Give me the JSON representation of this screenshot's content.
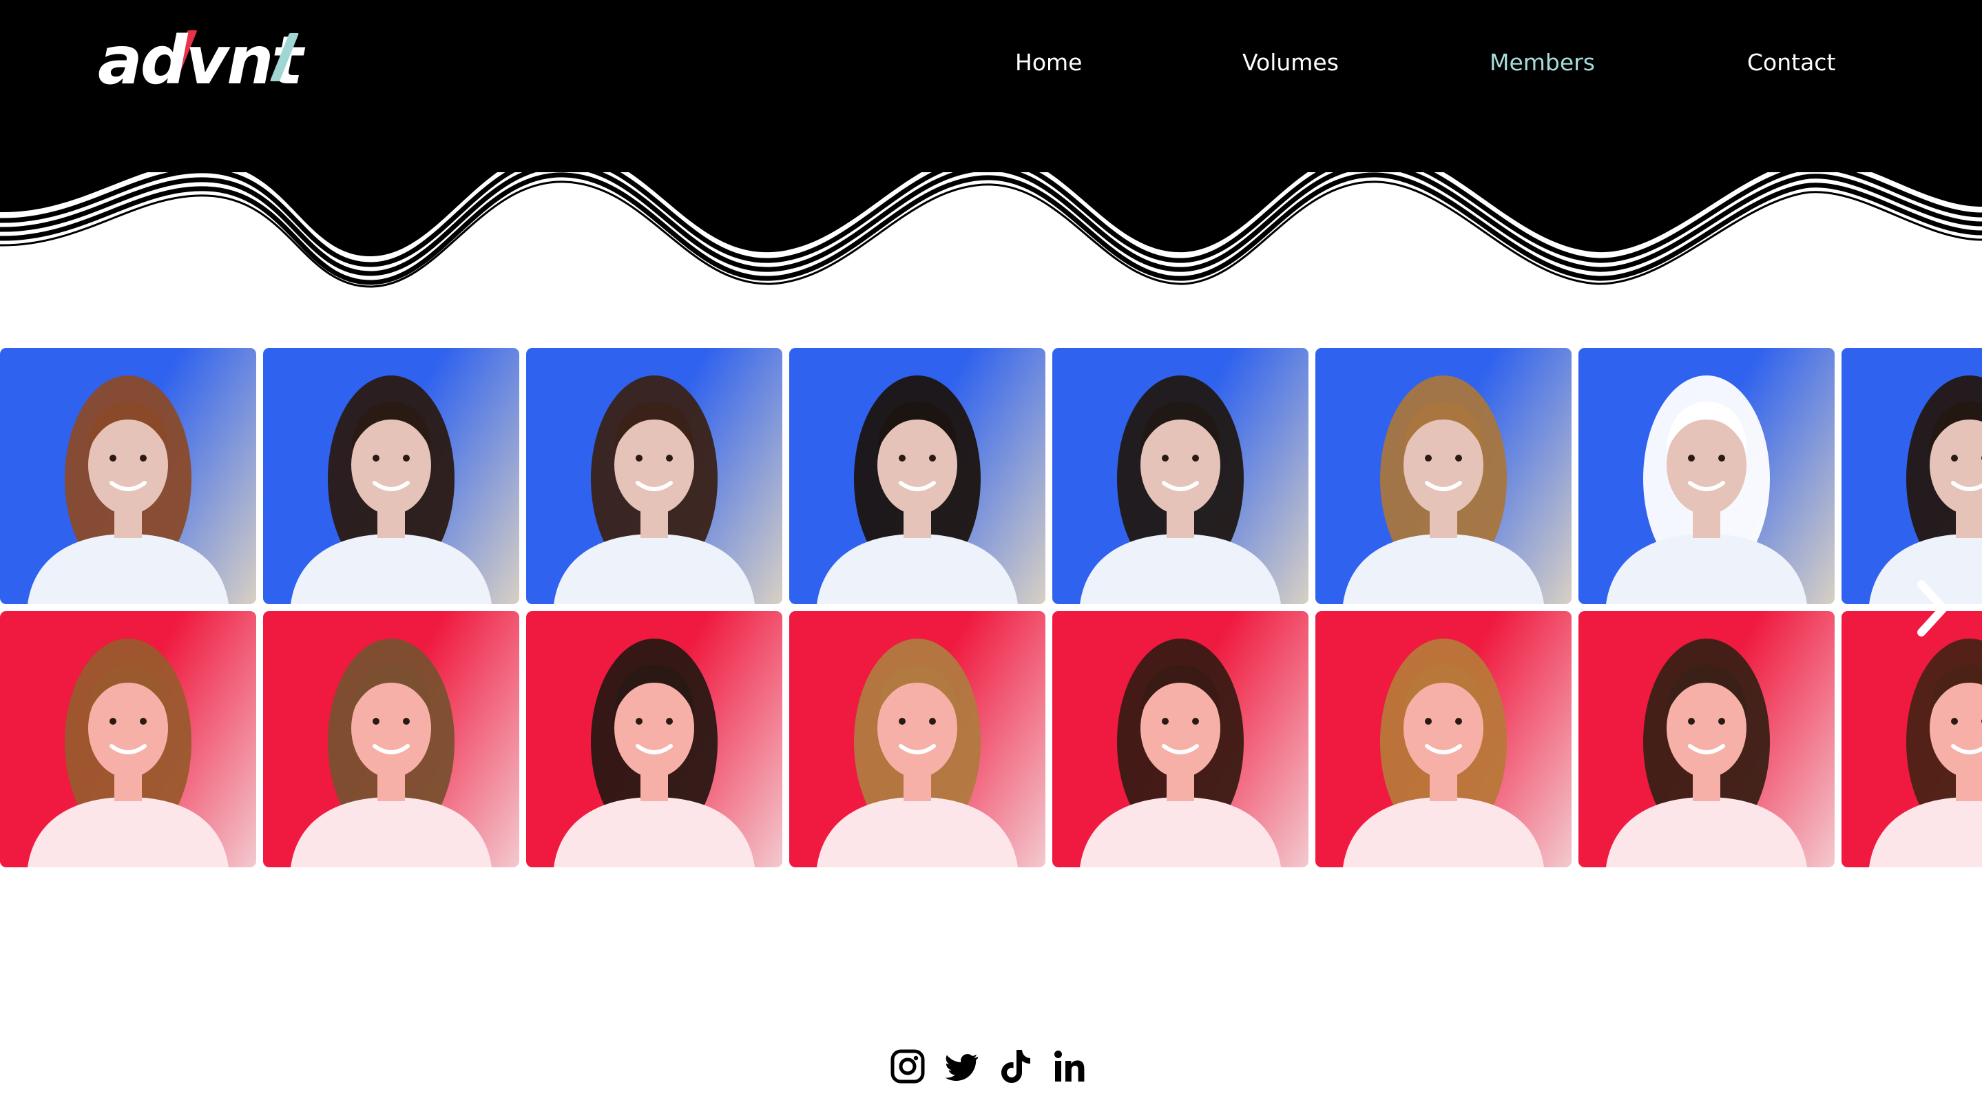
{
  "brand": {
    "logo_text": "advnt",
    "accent_red": "#e8334a",
    "accent_teal": "#9fd6d4"
  },
  "nav": {
    "items": [
      {
        "label": "Home",
        "active": false
      },
      {
        "label": "Volumes",
        "active": false
      },
      {
        "label": "Members",
        "active": true
      },
      {
        "label": "Contact",
        "active": false
      }
    ],
    "active_color": "#a6dcdc"
  },
  "gallery": {
    "rows": [
      {
        "tint": "blue",
        "background": "#2f62ee",
        "highlight": "#d8d0c4",
        "count": 8
      },
      {
        "tint": "red",
        "background": "#f0193f",
        "highlight": "#f3c9cf",
        "count": 8
      }
    ],
    "next_icon": "chevron-right-icon"
  },
  "social": {
    "icons": [
      "instagram-icon",
      "twitter-icon",
      "tiktok-icon",
      "linkedin-icon"
    ]
  }
}
